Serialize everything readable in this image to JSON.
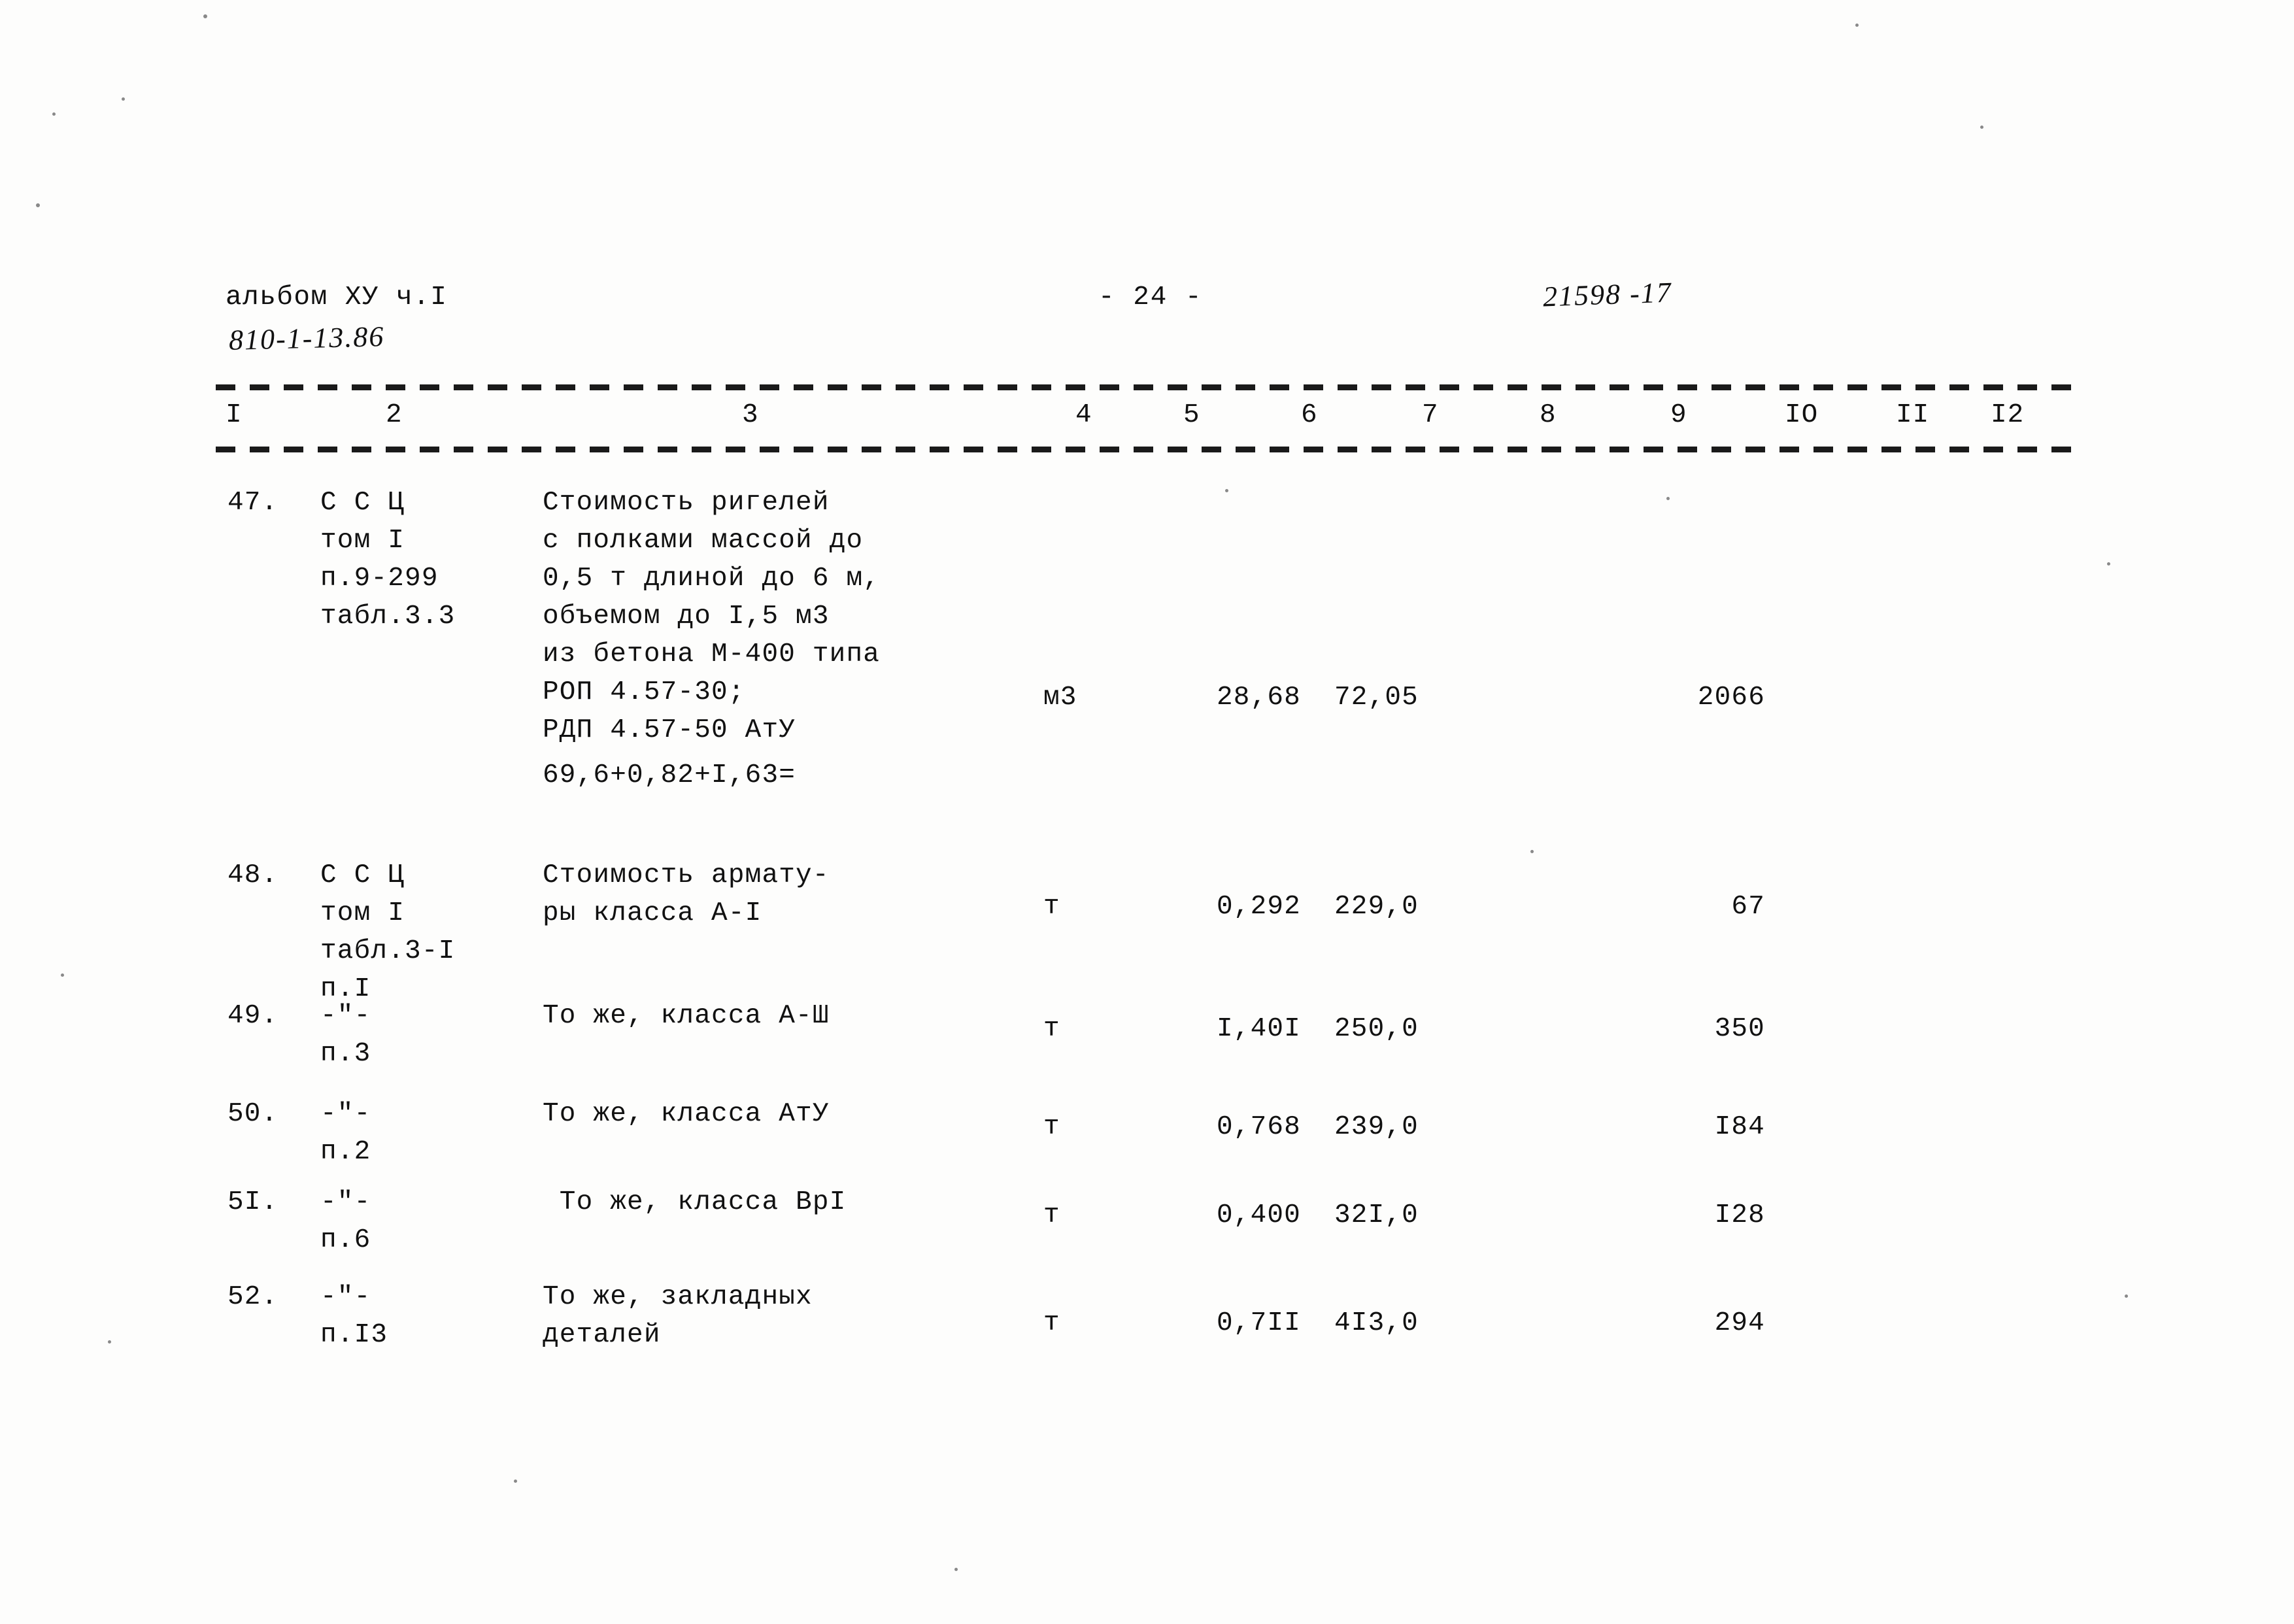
{
  "header": {
    "album": "альбом ХУ ч.I",
    "code": "810-1-13.86",
    "page_marker": "- 24 -",
    "stamp": "21598 -17"
  },
  "table": {
    "column_numbers": [
      "I",
      "2",
      "3",
      "4",
      "5",
      "6",
      "7",
      "8",
      "9",
      "IO",
      "II",
      "I2"
    ],
    "rows": [
      {
        "num": "47.",
        "ref_lines": [
          "С С Ц",
          "том I",
          "п.9-299",
          "табл.3.3"
        ],
        "desc_lines": [
          "Стоимость ригелей",
          "с полками массой до",
          "0,5 т длиной до 6 м,",
          "объемом до I,5 м3",
          "из бетона М-400 типа",
          "РОП 4.57-30;",
          "РДП 4.57-50 АтУ"
        ],
        "unit": "м3",
        "qty": "28,68",
        "price": "72,05",
        "total": "2066",
        "formula": "69,6+0,82+I,63="
      },
      {
        "num": "48.",
        "ref_lines": [
          "С С Ц",
          "том I",
          "табл.3-I",
          "п.I"
        ],
        "desc_lines": [
          "Стоимость армату-",
          "ры класса А-I"
        ],
        "unit": "т",
        "qty": "0,292",
        "price": "229,0",
        "total": "67",
        "formula": ""
      },
      {
        "num": "49.",
        "ref_lines": [
          "-\"-",
          "п.3"
        ],
        "desc_lines": [
          "То же, класса А-Ш"
        ],
        "unit": "т",
        "qty": "I,40I",
        "price": "250,0",
        "total": "350",
        "formula": ""
      },
      {
        "num": "50.",
        "ref_lines": [
          "-\"-",
          "п.2"
        ],
        "desc_lines": [
          "То же, класса АтУ"
        ],
        "unit": "т",
        "qty": "0,768",
        "price": "239,0",
        "total": "I84",
        "formula": ""
      },
      {
        "num": "5I.",
        "ref_lines": [
          "-\"-",
          "п.6"
        ],
        "desc_lines": [
          " То же, класса ВрI"
        ],
        "unit": "т",
        "qty": "0,400",
        "price": "32I,0",
        "total": "I28",
        "formula": ""
      },
      {
        "num": "52.",
        "ref_lines": [
          "-\"-",
          "п.I3"
        ],
        "desc_lines": [
          "То же, закладных",
          "деталей"
        ],
        "unit": "т",
        "qty": "0,7II",
        "price": "4I3,0",
        "total": "294",
        "formula": ""
      }
    ]
  }
}
